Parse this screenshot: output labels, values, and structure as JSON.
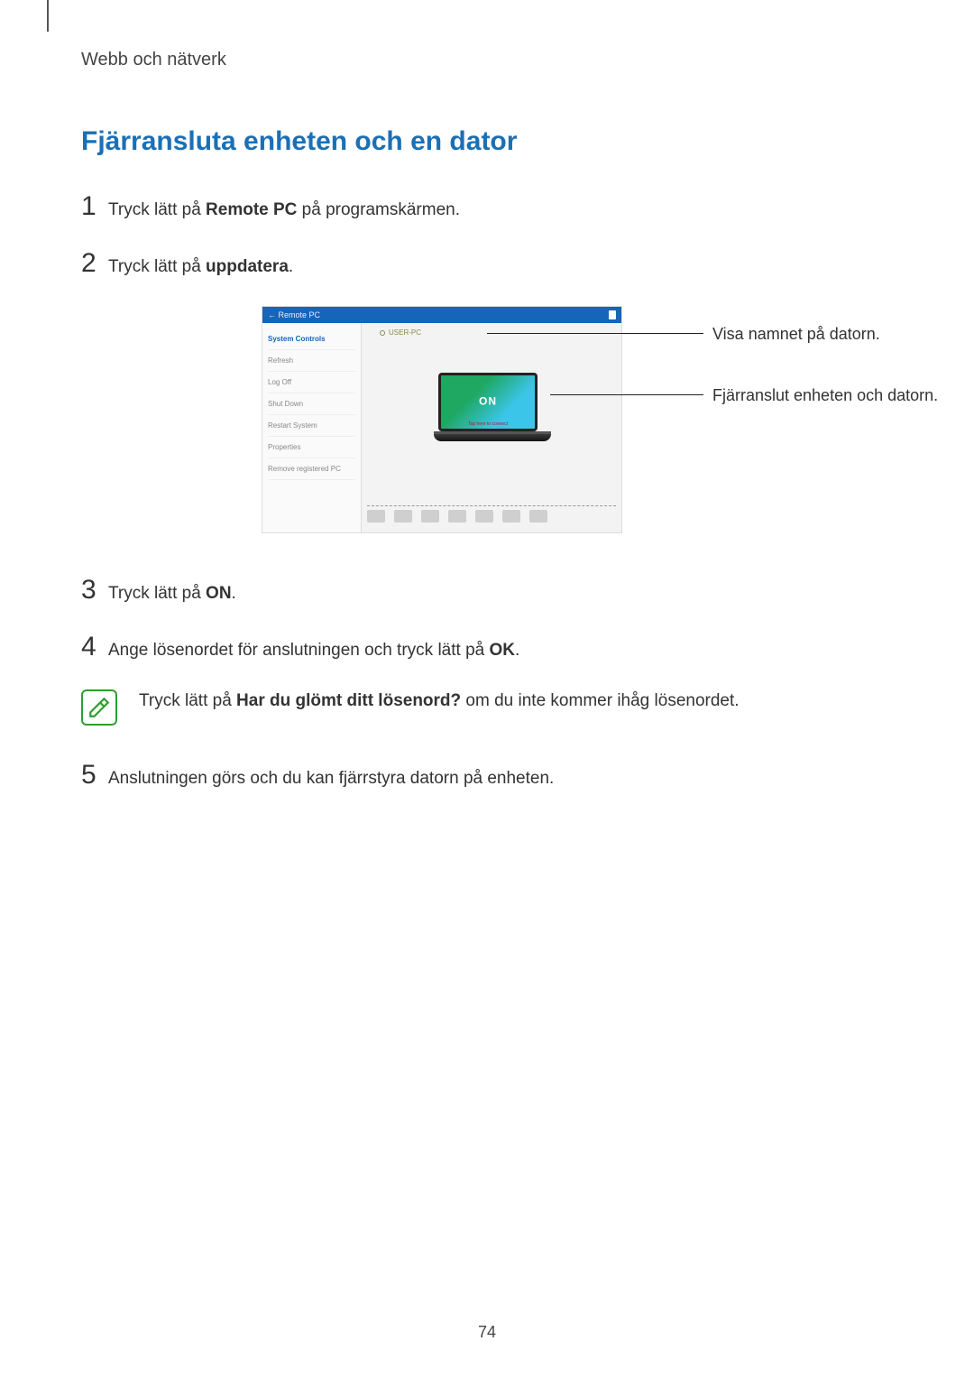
{
  "breadcrumb": "Webb och nätverk",
  "title": "Fjärransluta enheten och en dator",
  "steps": {
    "s1": {
      "num": "1",
      "pre": "Tryck lätt på ",
      "bold": "Remote PC",
      "post": " på programskärmen."
    },
    "s2": {
      "num": "2",
      "pre": "Tryck lätt på ",
      "bold": "uppdatera",
      "post": "."
    },
    "s3": {
      "num": "3",
      "pre": "Tryck lätt på ",
      "bold": "ON",
      "post": "."
    },
    "s4": {
      "num": "4",
      "pre": "Ange lösenordet för anslutningen och tryck lätt på ",
      "bold": "OK",
      "post": "."
    },
    "s5": {
      "num": "5",
      "text": "Anslutningen görs och du kan fjärrstyra datorn på enheten."
    }
  },
  "note": {
    "pre": "Tryck lätt på ",
    "bold": "Har du glömt ditt lösenord?",
    "post": " om du inte kommer ihåg lösenordet."
  },
  "figure": {
    "header": "←  Remote PC",
    "sidebar": {
      "i0": "System Controls",
      "i1": "Refresh",
      "i2": "Log Off",
      "i3": "Shut Down",
      "i4": "Restart System",
      "i5": "Properties",
      "i6": "Remove registered PC"
    },
    "pc_label": "USER-PC",
    "on_label": "ON",
    "sub_label": "Tap here to connect"
  },
  "callouts": {
    "c1": "Visa namnet på datorn.",
    "c2": "Fjärranslut enheten och datorn."
  },
  "page_number": "74"
}
